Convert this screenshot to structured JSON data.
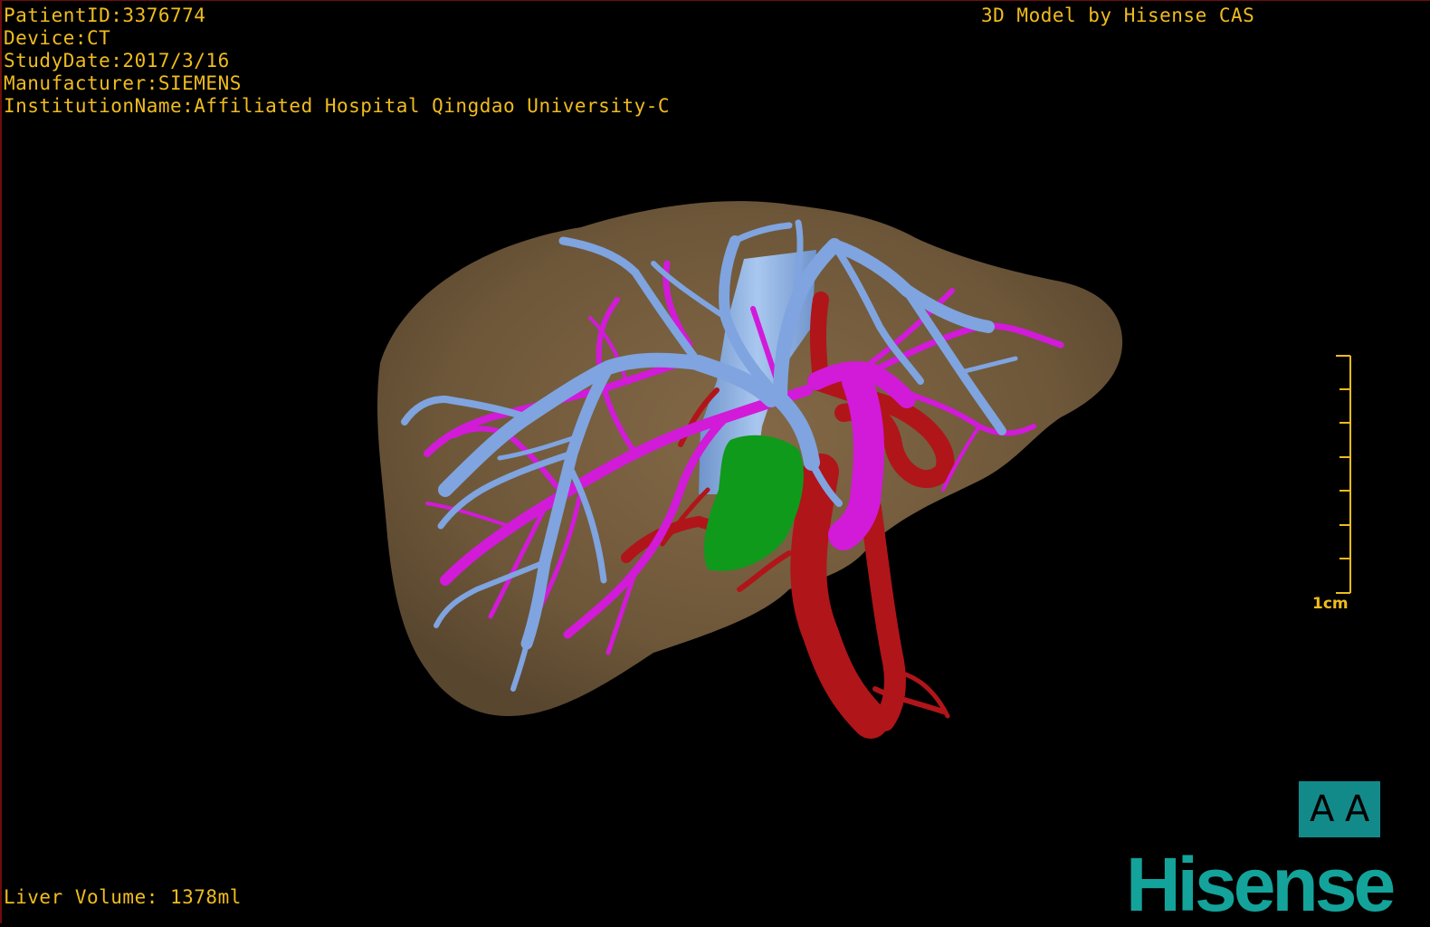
{
  "overlay": {
    "patient_id": "PatientID:3376774",
    "device": "Device:CT",
    "study_date": "StudyDate:2017/3/16",
    "manufacturer": "Manufacturer:SIEMENS",
    "institution": "InstitutionName:Affiliated Hospital Qingdao University-C",
    "title": "3D Model by Hisense CAS",
    "liver_volume": "Liver Volume: 1378ml"
  },
  "scale": {
    "label": "1cm"
  },
  "orientation": {
    "left": "A",
    "right": "A"
  },
  "brand": {
    "name": "Hisense"
  },
  "colors": {
    "text": "#f0bc1e",
    "background": "#000000",
    "liver": "#7a6241",
    "portal_vein": "#7fa4e0",
    "hepatic_vein": "#d21ad9",
    "artery": "#b0151a",
    "gallbladder": "#0f9a1c",
    "brand": "#13a39a"
  },
  "icons": [
    "orientation-cube-icon",
    "hisense-logo"
  ]
}
